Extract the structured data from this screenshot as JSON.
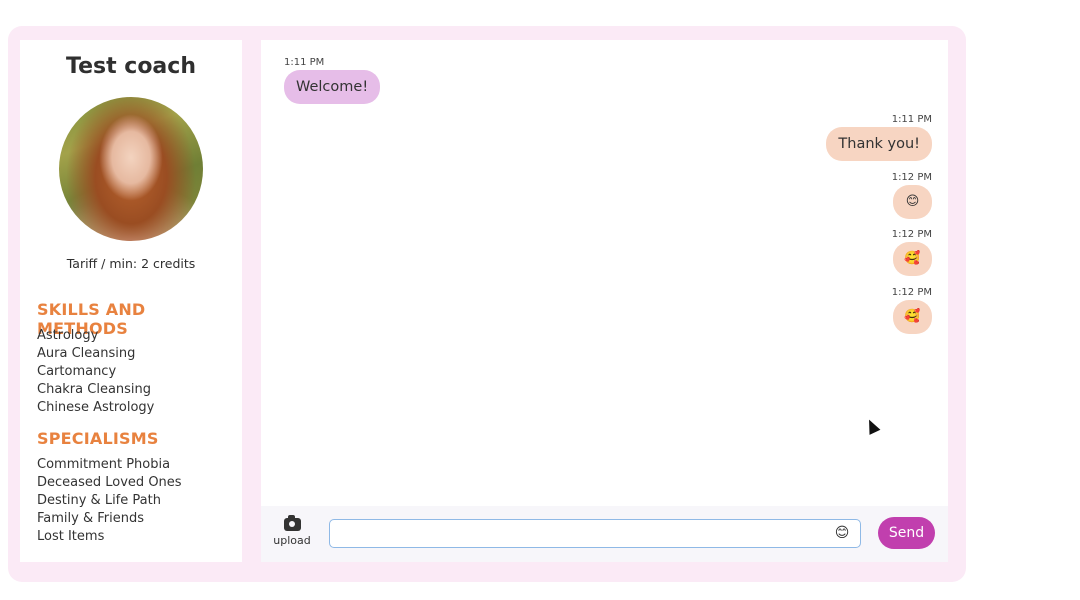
{
  "coach": {
    "name": "Test coach",
    "tariff": "Tariff / min: 2 credits"
  },
  "skills": {
    "title": "SKILLS AND METHODS",
    "items": [
      "Astrology",
      "Aura Cleansing",
      "Cartomancy",
      "Chakra Cleansing",
      "Chinese Astrology"
    ]
  },
  "specialisms": {
    "title": "SPECIALISMS",
    "items": [
      "Commitment Phobia",
      "Deceased Loved Ones",
      "Destiny & Life Path",
      "Family & Friends",
      "Lost Items"
    ]
  },
  "messages": [
    {
      "time": "1:11 PM",
      "text": "Welcome!",
      "side": "left"
    },
    {
      "time": "1:11 PM",
      "text": "Thank you!",
      "side": "right"
    },
    {
      "time": "1:12 PM",
      "text": "😊",
      "side": "right"
    },
    {
      "time": "1:12 PM",
      "text": "🥰",
      "side": "right"
    },
    {
      "time": "1:12 PM",
      "text": "🥰",
      "side": "right"
    }
  ],
  "composer": {
    "upload_label": "upload",
    "input_value": "",
    "emoji": "😊",
    "send_label": "Send"
  },
  "colors": {
    "accent": "#e8823f",
    "send": "#c13fae",
    "incoming_bubble": "#e6bde8",
    "outgoing_bubble": "#f7d5c2"
  },
  "icons": {
    "upload": "camera-icon",
    "emoji": "smiley-icon"
  }
}
